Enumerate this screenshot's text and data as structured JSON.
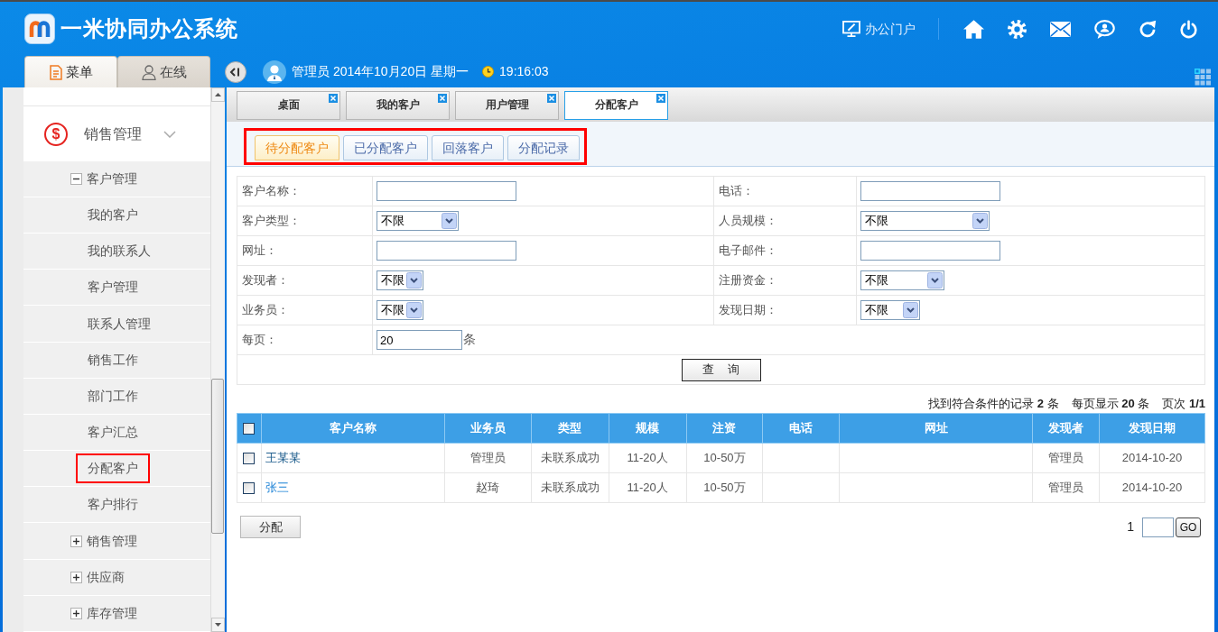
{
  "header": {
    "title": "一米协同办公系统",
    "portal_link": "办公门户"
  },
  "sidebar_tabs": [
    {
      "label": "菜单",
      "selected": true
    },
    {
      "label": "在线",
      "selected": false
    }
  ],
  "user_bar": {
    "info": "管理员 2014年10月20日 星期一",
    "time": "19:16:03"
  },
  "page_tabs": [
    {
      "label": "桌面",
      "selected": false
    },
    {
      "label": "我的客户",
      "selected": false
    },
    {
      "label": "用户管理",
      "selected": false
    },
    {
      "label": "分配客户",
      "selected": true
    }
  ],
  "sidebar": {
    "section": {
      "icon": "$",
      "label": "销售管理",
      "expanded": true,
      "children": [
        {
          "label": "客户管理",
          "expanded": true,
          "children": [
            {
              "label": "我的客户",
              "selected": false
            },
            {
              "label": "我的联系人",
              "selected": false
            },
            {
              "label": "客户管理",
              "selected": false
            },
            {
              "label": "联系人管理",
              "selected": false
            },
            {
              "label": "销售工作",
              "selected": false
            },
            {
              "label": "部门工作",
              "selected": false
            },
            {
              "label": "客户汇总",
              "selected": false
            },
            {
              "label": "分配客户",
              "selected": true
            },
            {
              "label": "客户排行",
              "selected": false
            }
          ]
        },
        {
          "label": "销售管理",
          "expanded": false
        },
        {
          "label": "供应商",
          "expanded": false
        },
        {
          "label": "库存管理",
          "expanded": false
        }
      ]
    }
  },
  "sub_tabs": {
    "highlighted": true,
    "items": [
      {
        "label": "待分配客户",
        "selected": true
      },
      {
        "label": "已分配客户",
        "selected": false
      },
      {
        "label": "回落客户",
        "selected": false
      },
      {
        "label": "分配记录",
        "selected": false
      }
    ]
  },
  "search_form": {
    "fields": [
      {
        "label": "客户名称：",
        "kind": "text"
      },
      {
        "label": "电话：",
        "kind": "text"
      },
      {
        "label": "客户类型：",
        "kind": "select",
        "value": "不限"
      },
      {
        "label": "人员规模：",
        "kind": "select",
        "value": "不限"
      },
      {
        "label": "网址：",
        "kind": "text"
      },
      {
        "label": "电子邮件：",
        "kind": "text"
      },
      {
        "label": "发现者：",
        "kind": "select",
        "value": "不限"
      },
      {
        "label": "注册资金：",
        "kind": "select",
        "value": "不限"
      },
      {
        "label": "业务员：",
        "kind": "select",
        "value": "不限"
      },
      {
        "label": "发现日期：",
        "kind": "select",
        "value": "不限"
      }
    ],
    "per_page": {
      "label": "每页：",
      "value": "20",
      "unit": "条"
    },
    "submit_button": "查 询"
  },
  "result_summary": [
    "找到符合条件的记录 **2** 条",
    "每页显示 **20** 条",
    "页次 **1/1**"
  ],
  "table": {
    "select_all_checked": false,
    "columns": [
      "客户名称",
      "业务员",
      "类型",
      "规模",
      "注资",
      "电话",
      "网址",
      "发现者",
      "发现日期"
    ],
    "rows": [
      {
        "checked": false,
        "visited": true,
        "name": "王某某",
        "salesperson": "管理员",
        "type": "未联系成功",
        "size": "11-20人",
        "capital": "10-50万",
        "discoverer": "管理员",
        "found_date": "2014-10-20"
      },
      {
        "checked": false,
        "visited": false,
        "name": "张三",
        "salesperson": "赵琦",
        "type": "未联系成功",
        "size": "11-20人",
        "capital": "10-50万",
        "discoverer": "管理员",
        "found_date": "2014-10-20"
      }
    ]
  },
  "assign_button": "分配",
  "pagination": {
    "current_page": "1",
    "go_button": "GO"
  }
}
